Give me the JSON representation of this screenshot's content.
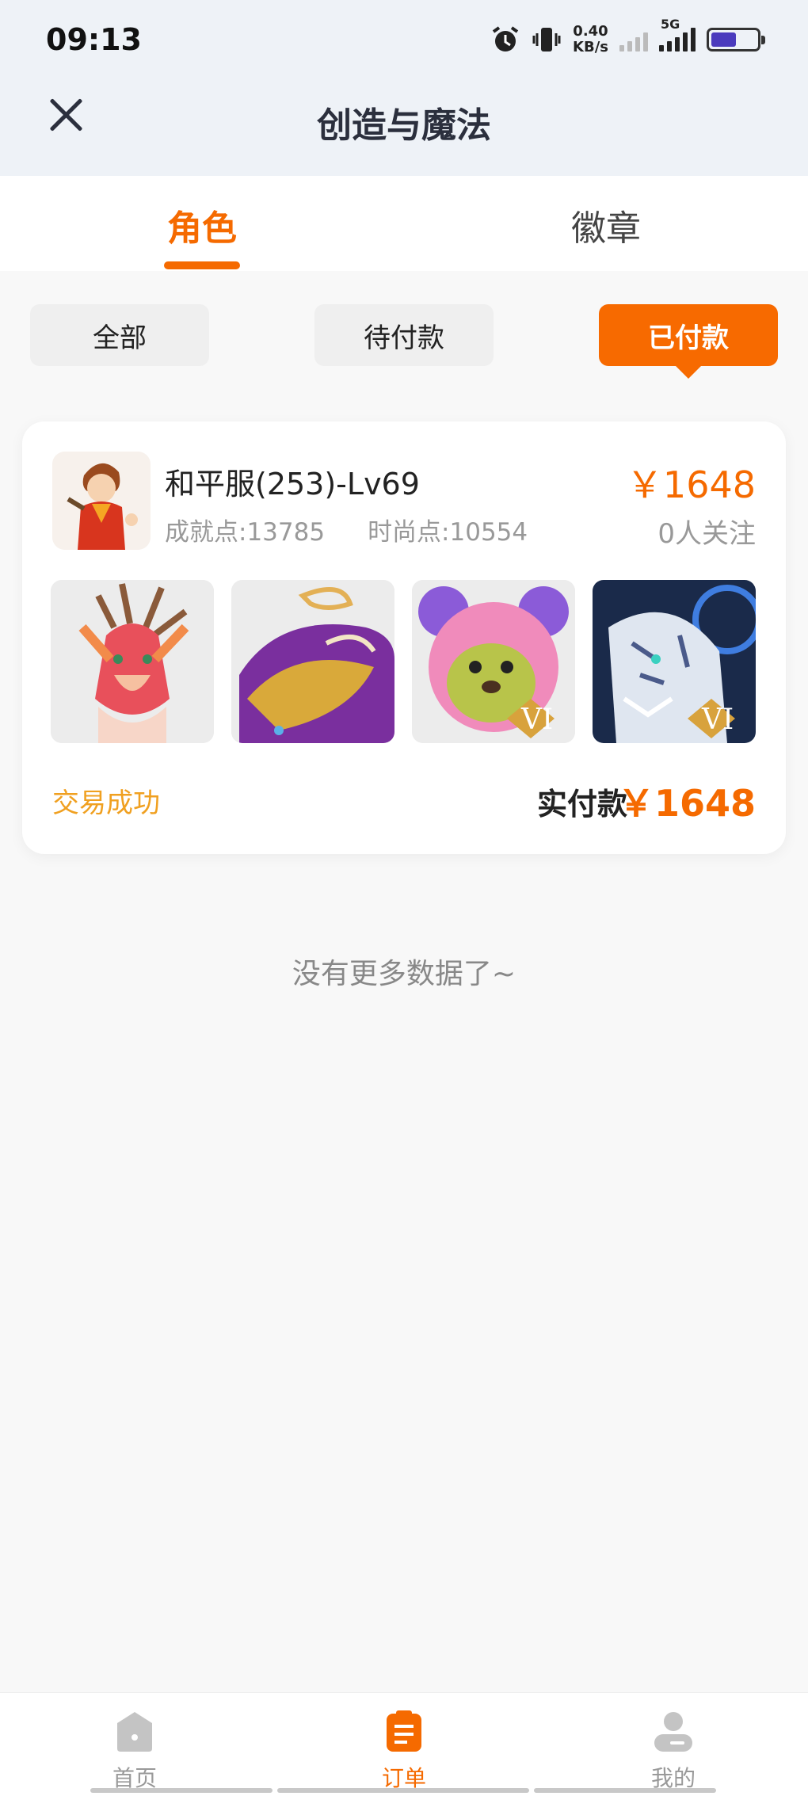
{
  "status_bar": {
    "time": "09:13",
    "net_speed_value": "0.40",
    "net_speed_unit": "KB/s",
    "network_type": "5G",
    "battery_level": 0.55
  },
  "header": {
    "title": "创造与魔法"
  },
  "tabs": [
    {
      "label": "角色",
      "active": true
    },
    {
      "label": "徽章",
      "active": false
    }
  ],
  "filters": [
    {
      "label": "全部",
      "active": false
    },
    {
      "label": "待付款",
      "active": false
    },
    {
      "label": "已付款",
      "active": true
    }
  ],
  "order": {
    "server_level": "和平服(253)-Lv69",
    "achievement_points": "成就点:13785",
    "fashion_points": "时尚点:10554",
    "price": "￥1648",
    "followers": "0人关注",
    "thumbnails": [
      {
        "name": "red-dragon-mount-image",
        "tag": ""
      },
      {
        "name": "golden-whale-mount-image",
        "tag": ""
      },
      {
        "name": "pink-bear-costume-image",
        "tag": "VI"
      },
      {
        "name": "white-tiger-mount-image",
        "tag": "VI"
      }
    ],
    "status": "交易成功",
    "paid_label": "实付款",
    "paid_amount": "￥1648"
  },
  "footer_note": "没有更多数据了~",
  "bottom_nav": [
    {
      "label": "首页",
      "icon": "home-icon",
      "active": false
    },
    {
      "label": "订单",
      "icon": "orders-icon",
      "active": true
    },
    {
      "label": "我的",
      "icon": "profile-icon",
      "active": false
    }
  ],
  "colors": {
    "accent": "#f56a00",
    "status_success": "#f0a020",
    "header_bg": "#eef2f7"
  }
}
